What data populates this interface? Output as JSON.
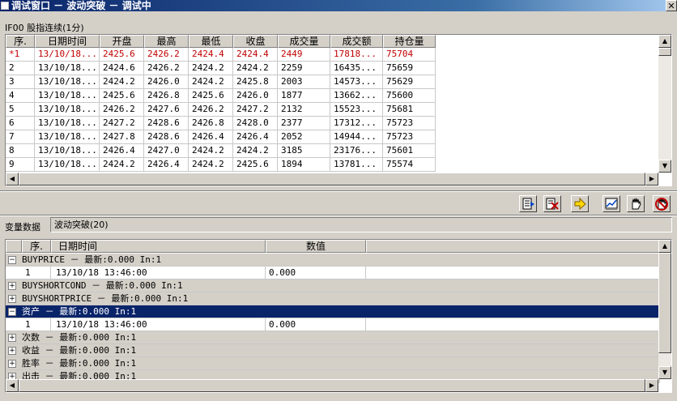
{
  "window": {
    "title": "调试窗口 － 波动突破 － 调试中",
    "close_glyph": "✕"
  },
  "symbol": {
    "label": "IF00 股指连续(1分)"
  },
  "quote_table": {
    "columns": [
      "序.",
      "日期时间",
      "开盘",
      "最高",
      "最低",
      "收盘",
      "成交量",
      "成交额",
      "持仓量"
    ],
    "rows": [
      [
        "*1",
        "13/10/18...",
        "2425.6",
        "2426.2",
        "2424.4",
        "2424.4",
        "2449",
        "17818...",
        "75704"
      ],
      [
        "2",
        "13/10/18...",
        "2424.6",
        "2426.2",
        "2424.2",
        "2424.2",
        "2259",
        "16435...",
        "75659"
      ],
      [
        "3",
        "13/10/18...",
        "2424.2",
        "2426.0",
        "2424.2",
        "2425.8",
        "2003",
        "14573...",
        "75629"
      ],
      [
        "4",
        "13/10/18...",
        "2425.6",
        "2426.8",
        "2425.6",
        "2426.0",
        "1877",
        "13662...",
        "75600"
      ],
      [
        "5",
        "13/10/18...",
        "2426.2",
        "2427.6",
        "2426.2",
        "2427.2",
        "2132",
        "15523...",
        "75681"
      ],
      [
        "6",
        "13/10/18...",
        "2427.2",
        "2428.6",
        "2426.8",
        "2428.0",
        "2377",
        "17312...",
        "75723"
      ],
      [
        "7",
        "13/10/18...",
        "2427.8",
        "2428.6",
        "2426.4",
        "2426.4",
        "2052",
        "14944...",
        "75723"
      ],
      [
        "8",
        "13/10/18...",
        "2426.4",
        "2427.0",
        "2424.2",
        "2424.2",
        "3185",
        "23176...",
        "75601"
      ],
      [
        "9",
        "13/10/18...",
        "2424.2",
        "2426.4",
        "2424.2",
        "2425.6",
        "1894",
        "13781...",
        "75574"
      ]
    ]
  },
  "toolbar": {
    "buttons": [
      {
        "name": "step-into-button",
        "icon": "step-icon"
      },
      {
        "name": "clear-button",
        "icon": "clear-icon"
      },
      {
        "name": "next-button",
        "icon": "arrow-right-icon"
      },
      {
        "name": "chart-button",
        "icon": "chart-icon"
      },
      {
        "name": "pause-button",
        "icon": "hand-icon"
      },
      {
        "name": "stop-button",
        "icon": "stop-hand-icon"
      }
    ]
  },
  "variables": {
    "label": "变量数据",
    "strategy": "波动突破(20)",
    "columns": [
      "序.",
      "日期时间",
      "数值"
    ],
    "groups": [
      {
        "expanded": true,
        "selected": false,
        "text": "BUYPRICE － 最新:0.000 In:1",
        "child": [
          "1",
          "13/10/18 13:46:00",
          "0.000"
        ]
      },
      {
        "expanded": false,
        "selected": false,
        "text": "BUYSHORTCOND － 最新:0.000 In:1"
      },
      {
        "expanded": false,
        "selected": false,
        "text": "BUYSHORTPRICE － 最新:0.000 In:1"
      },
      {
        "expanded": true,
        "selected": true,
        "text": "资产 － 最新:0.000 In:1",
        "child": [
          "1",
          "13/10/18 13:46:00",
          "0.000"
        ]
      },
      {
        "expanded": false,
        "selected": false,
        "text": "次数 － 最新:0.000 In:1"
      },
      {
        "expanded": false,
        "selected": false,
        "text": "收益 － 最新:0.000 In:1"
      },
      {
        "expanded": false,
        "selected": false,
        "text": "胜率 － 最新:0.000 In:1"
      },
      {
        "expanded": false,
        "selected": false,
        "text": "出击 － 最新:0.000 In:1"
      }
    ]
  },
  "colors": {
    "title_bar": "#0a246a",
    "highlight_row_text": "#c00000",
    "selected_row": "#0a246a"
  }
}
